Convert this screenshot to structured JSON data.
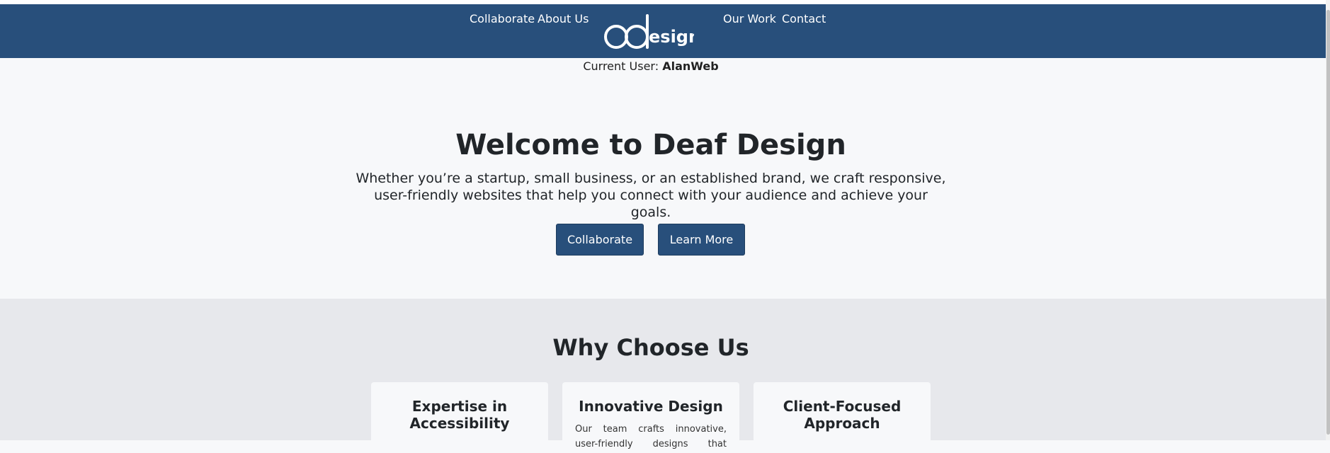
{
  "nav": {
    "left_links": [
      "Collaborate",
      "About Us"
    ],
    "right_links": [
      "Our Work",
      "Contact"
    ],
    "logo_text": "dDesign"
  },
  "current_user": {
    "label": "Current User:",
    "name": "AlanWeb"
  },
  "hero": {
    "title": "Welcome to Deaf Design",
    "description": "Whether you’re a startup, small business, or an established brand, we craft responsive, user-friendly websites that help you connect with your audience and achieve your goals.",
    "buttons": [
      "Collaborate",
      "Learn More"
    ]
  },
  "why": {
    "title": "Why Choose Us",
    "cards": [
      {
        "title": "Expertise in Accessibility",
        "text": ""
      },
      {
        "title": "Innovative Design",
        "text": "Our team crafts innovative, user-friendly designs that captivate"
      },
      {
        "title": "Client-Focused Approach",
        "text": ""
      }
    ]
  },
  "colors": {
    "navbar": "#284f7b",
    "button": "#284f7b",
    "why_bg": "#e7e8ec",
    "page_bg": "#f7f8fa"
  }
}
